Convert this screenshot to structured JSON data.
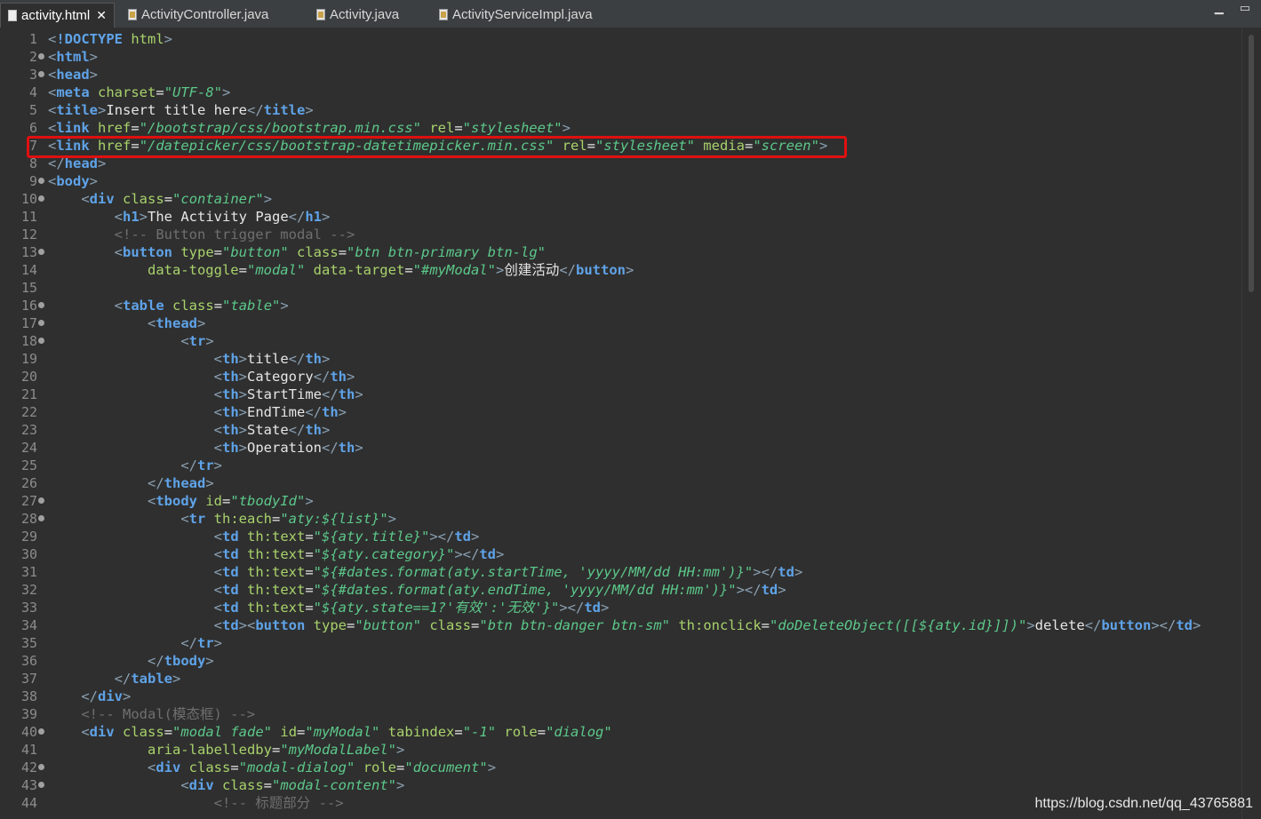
{
  "tabs": [
    {
      "label": "activity.html",
      "active": true,
      "icon": "html-file-icon"
    },
    {
      "label": "ActivityController.java",
      "active": false,
      "icon": "java-file-icon"
    },
    {
      "label": "Activity.java",
      "active": false,
      "icon": "java-file-icon"
    },
    {
      "label": "ActivityServiceImpl.java",
      "active": false,
      "icon": "java-file-icon"
    }
  ],
  "window_controls": [
    "minimize-icon",
    "maximize-icon"
  ],
  "close_glyph": "✕",
  "line_numbers": [
    "1",
    "2",
    "3",
    "4",
    "5",
    "6",
    "7",
    "8",
    "9",
    "10",
    "11",
    "12",
    "13",
    "14",
    "15",
    "16",
    "17",
    "18",
    "19",
    "20",
    "21",
    "22",
    "23",
    "24",
    "25",
    "26",
    "27",
    "28",
    "29",
    "30",
    "31",
    "32",
    "33",
    "34",
    "35",
    "36",
    "37",
    "38",
    "39",
    "40",
    "41",
    "42",
    "43",
    "44"
  ],
  "folded_lines": [
    2,
    3,
    9,
    10,
    13,
    16,
    17,
    18,
    27,
    28,
    40,
    42,
    43
  ],
  "highlighted_line": 7,
  "code_lines": [
    [
      [
        "p",
        "<"
      ],
      [
        "t",
        "!DOCTYPE"
      ],
      [
        "x",
        " "
      ],
      [
        "a",
        "html"
      ],
      [
        "p",
        ">"
      ]
    ],
    [
      [
        "p",
        "<"
      ],
      [
        "t",
        "html"
      ],
      [
        "p",
        ">"
      ]
    ],
    [
      [
        "p",
        "<"
      ],
      [
        "t",
        "head"
      ],
      [
        "p",
        ">"
      ]
    ],
    [
      [
        "p",
        "<"
      ],
      [
        "t",
        "meta"
      ],
      [
        "x",
        " "
      ],
      [
        "a",
        "charset"
      ],
      [
        "x",
        "="
      ],
      [
        "v",
        "\"UTF-8\""
      ],
      [
        "p",
        ">"
      ]
    ],
    [
      [
        "p",
        "<"
      ],
      [
        "t",
        "title"
      ],
      [
        "p",
        ">"
      ],
      [
        "x",
        "Insert title here"
      ],
      [
        "p",
        "</"
      ],
      [
        "t",
        "title"
      ],
      [
        "p",
        ">"
      ]
    ],
    [
      [
        "p",
        "<"
      ],
      [
        "t",
        "link"
      ],
      [
        "x",
        " "
      ],
      [
        "a",
        "href"
      ],
      [
        "x",
        "="
      ],
      [
        "v",
        "\"/bootstrap/css/bootstrap.min.css\""
      ],
      [
        "x",
        " "
      ],
      [
        "a",
        "rel"
      ],
      [
        "x",
        "="
      ],
      [
        "v",
        "\"stylesheet\""
      ],
      [
        "p",
        ">"
      ]
    ],
    [
      [
        "p",
        "<"
      ],
      [
        "t",
        "link"
      ],
      [
        "x",
        " "
      ],
      [
        "a",
        "href"
      ],
      [
        "x",
        "="
      ],
      [
        "v",
        "\"/datepicker/css/bootstrap-datetimepicker.min.css\""
      ],
      [
        "x",
        " "
      ],
      [
        "a",
        "rel"
      ],
      [
        "x",
        "="
      ],
      [
        "v",
        "\"stylesheet\""
      ],
      [
        "x",
        " "
      ],
      [
        "a",
        "media"
      ],
      [
        "x",
        "="
      ],
      [
        "v",
        "\"screen\""
      ],
      [
        "p",
        ">"
      ]
    ],
    [
      [
        "p",
        "</"
      ],
      [
        "t",
        "head"
      ],
      [
        "p",
        ">"
      ]
    ],
    [
      [
        "p",
        "<"
      ],
      [
        "t",
        "body"
      ],
      [
        "p",
        ">"
      ]
    ],
    [
      [
        "x",
        "    "
      ],
      [
        "p",
        "<"
      ],
      [
        "t",
        "div"
      ],
      [
        "x",
        " "
      ],
      [
        "a",
        "class"
      ],
      [
        "x",
        "="
      ],
      [
        "v",
        "\"container\""
      ],
      [
        "p",
        ">"
      ]
    ],
    [
      [
        "x",
        "        "
      ],
      [
        "p",
        "<"
      ],
      [
        "t",
        "h1"
      ],
      [
        "p",
        ">"
      ],
      [
        "x",
        "The Activity Page"
      ],
      [
        "p",
        "</"
      ],
      [
        "t",
        "h1"
      ],
      [
        "p",
        ">"
      ]
    ],
    [
      [
        "x",
        "        "
      ],
      [
        "c",
        "<!-- Button trigger modal -->"
      ]
    ],
    [
      [
        "x",
        "        "
      ],
      [
        "p",
        "<"
      ],
      [
        "t",
        "button"
      ],
      [
        "x",
        " "
      ],
      [
        "a",
        "type"
      ],
      [
        "x",
        "="
      ],
      [
        "v",
        "\"button\""
      ],
      [
        "x",
        " "
      ],
      [
        "a",
        "class"
      ],
      [
        "x",
        "="
      ],
      [
        "v",
        "\"btn btn-primary btn-lg\""
      ]
    ],
    [
      [
        "x",
        "            "
      ],
      [
        "a",
        "data-toggle"
      ],
      [
        "x",
        "="
      ],
      [
        "v",
        "\"modal\""
      ],
      [
        "x",
        " "
      ],
      [
        "a",
        "data-target"
      ],
      [
        "x",
        "="
      ],
      [
        "v",
        "\"#myModal\""
      ],
      [
        "p",
        ">"
      ],
      [
        "x",
        "创建活动"
      ],
      [
        "p",
        "</"
      ],
      [
        "t",
        "button"
      ],
      [
        "p",
        ">"
      ]
    ],
    [
      [
        "x",
        ""
      ]
    ],
    [
      [
        "x",
        "        "
      ],
      [
        "p",
        "<"
      ],
      [
        "t",
        "table"
      ],
      [
        "x",
        " "
      ],
      [
        "a",
        "class"
      ],
      [
        "x",
        "="
      ],
      [
        "v",
        "\"table\""
      ],
      [
        "p",
        ">"
      ]
    ],
    [
      [
        "x",
        "            "
      ],
      [
        "p",
        "<"
      ],
      [
        "t",
        "thead"
      ],
      [
        "p",
        ">"
      ]
    ],
    [
      [
        "x",
        "                "
      ],
      [
        "p",
        "<"
      ],
      [
        "t",
        "tr"
      ],
      [
        "p",
        ">"
      ]
    ],
    [
      [
        "x",
        "                    "
      ],
      [
        "p",
        "<"
      ],
      [
        "t",
        "th"
      ],
      [
        "p",
        ">"
      ],
      [
        "x",
        "title"
      ],
      [
        "p",
        "</"
      ],
      [
        "t",
        "th"
      ],
      [
        "p",
        ">"
      ]
    ],
    [
      [
        "x",
        "                    "
      ],
      [
        "p",
        "<"
      ],
      [
        "t",
        "th"
      ],
      [
        "p",
        ">"
      ],
      [
        "x",
        "Category"
      ],
      [
        "p",
        "</"
      ],
      [
        "t",
        "th"
      ],
      [
        "p",
        ">"
      ]
    ],
    [
      [
        "x",
        "                    "
      ],
      [
        "p",
        "<"
      ],
      [
        "t",
        "th"
      ],
      [
        "p",
        ">"
      ],
      [
        "x",
        "StartTime"
      ],
      [
        "p",
        "</"
      ],
      [
        "t",
        "th"
      ],
      [
        "p",
        ">"
      ]
    ],
    [
      [
        "x",
        "                    "
      ],
      [
        "p",
        "<"
      ],
      [
        "t",
        "th"
      ],
      [
        "p",
        ">"
      ],
      [
        "x",
        "EndTime"
      ],
      [
        "p",
        "</"
      ],
      [
        "t",
        "th"
      ],
      [
        "p",
        ">"
      ]
    ],
    [
      [
        "x",
        "                    "
      ],
      [
        "p",
        "<"
      ],
      [
        "t",
        "th"
      ],
      [
        "p",
        ">"
      ],
      [
        "x",
        "State"
      ],
      [
        "p",
        "</"
      ],
      [
        "t",
        "th"
      ],
      [
        "p",
        ">"
      ]
    ],
    [
      [
        "x",
        "                    "
      ],
      [
        "p",
        "<"
      ],
      [
        "t",
        "th"
      ],
      [
        "p",
        ">"
      ],
      [
        "x",
        "Operation"
      ],
      [
        "p",
        "</"
      ],
      [
        "t",
        "th"
      ],
      [
        "p",
        ">"
      ]
    ],
    [
      [
        "x",
        "                "
      ],
      [
        "p",
        "</"
      ],
      [
        "t",
        "tr"
      ],
      [
        "p",
        ">"
      ]
    ],
    [
      [
        "x",
        "            "
      ],
      [
        "p",
        "</"
      ],
      [
        "t",
        "thead"
      ],
      [
        "p",
        ">"
      ]
    ],
    [
      [
        "x",
        "            "
      ],
      [
        "p",
        "<"
      ],
      [
        "t",
        "tbody"
      ],
      [
        "x",
        " "
      ],
      [
        "a",
        "id"
      ],
      [
        "x",
        "="
      ],
      [
        "v",
        "\"tbodyId\""
      ],
      [
        "p",
        ">"
      ]
    ],
    [
      [
        "x",
        "                "
      ],
      [
        "p",
        "<"
      ],
      [
        "t",
        "tr"
      ],
      [
        "x",
        " "
      ],
      [
        "a",
        "th:each"
      ],
      [
        "x",
        "="
      ],
      [
        "v",
        "\"aty:${list}\""
      ],
      [
        "p",
        ">"
      ]
    ],
    [
      [
        "x",
        "                    "
      ],
      [
        "p",
        "<"
      ],
      [
        "t",
        "td"
      ],
      [
        "x",
        " "
      ],
      [
        "a",
        "th:text"
      ],
      [
        "x",
        "="
      ],
      [
        "v",
        "\"${aty.title}\""
      ],
      [
        "p",
        "></"
      ],
      [
        "t",
        "td"
      ],
      [
        "p",
        ">"
      ]
    ],
    [
      [
        "x",
        "                    "
      ],
      [
        "p",
        "<"
      ],
      [
        "t",
        "td"
      ],
      [
        "x",
        " "
      ],
      [
        "a",
        "th:text"
      ],
      [
        "x",
        "="
      ],
      [
        "v",
        "\"${aty.category}\""
      ],
      [
        "p",
        "></"
      ],
      [
        "t",
        "td"
      ],
      [
        "p",
        ">"
      ]
    ],
    [
      [
        "x",
        "                    "
      ],
      [
        "p",
        "<"
      ],
      [
        "t",
        "td"
      ],
      [
        "x",
        " "
      ],
      [
        "a",
        "th:text"
      ],
      [
        "x",
        "="
      ],
      [
        "v",
        "\"${#dates.format(aty.startTime, 'yyyy/MM/dd HH:mm')}\""
      ],
      [
        "p",
        "></"
      ],
      [
        "t",
        "td"
      ],
      [
        "p",
        ">"
      ]
    ],
    [
      [
        "x",
        "                    "
      ],
      [
        "p",
        "<"
      ],
      [
        "t",
        "td"
      ],
      [
        "x",
        " "
      ],
      [
        "a",
        "th:text"
      ],
      [
        "x",
        "="
      ],
      [
        "v",
        "\"${#dates.format(aty.endTime, 'yyyy/MM/dd HH:mm')}\""
      ],
      [
        "p",
        "></"
      ],
      [
        "t",
        "td"
      ],
      [
        "p",
        ">"
      ]
    ],
    [
      [
        "x",
        "                    "
      ],
      [
        "p",
        "<"
      ],
      [
        "t",
        "td"
      ],
      [
        "x",
        " "
      ],
      [
        "a",
        "th:text"
      ],
      [
        "x",
        "="
      ],
      [
        "v",
        "\"${aty.state==1?'有效':'无效'}\""
      ],
      [
        "p",
        "></"
      ],
      [
        "t",
        "td"
      ],
      [
        "p",
        ">"
      ]
    ],
    [
      [
        "x",
        "                    "
      ],
      [
        "p",
        "<"
      ],
      [
        "t",
        "td"
      ],
      [
        "p",
        "><"
      ],
      [
        "t",
        "button"
      ],
      [
        "x",
        " "
      ],
      [
        "a",
        "type"
      ],
      [
        "x",
        "="
      ],
      [
        "v",
        "\"button\""
      ],
      [
        "x",
        " "
      ],
      [
        "a",
        "class"
      ],
      [
        "x",
        "="
      ],
      [
        "v",
        "\"btn btn-danger btn-sm\""
      ],
      [
        "x",
        " "
      ],
      [
        "a",
        "th:onclick"
      ],
      [
        "x",
        "="
      ],
      [
        "v",
        "\"doDeleteObject([[${aty.id}]])\""
      ],
      [
        "p",
        ">"
      ],
      [
        "x",
        "delete"
      ],
      [
        "p",
        "</"
      ],
      [
        "t",
        "button"
      ],
      [
        "p",
        "></"
      ],
      [
        "t",
        "td"
      ],
      [
        "p",
        ">"
      ]
    ],
    [
      [
        "x",
        "                "
      ],
      [
        "p",
        "</"
      ],
      [
        "t",
        "tr"
      ],
      [
        "p",
        ">"
      ]
    ],
    [
      [
        "x",
        "            "
      ],
      [
        "p",
        "</"
      ],
      [
        "t",
        "tbody"
      ],
      [
        "p",
        ">"
      ]
    ],
    [
      [
        "x",
        "        "
      ],
      [
        "p",
        "</"
      ],
      [
        "t",
        "table"
      ],
      [
        "p",
        ">"
      ]
    ],
    [
      [
        "x",
        "    "
      ],
      [
        "p",
        "</"
      ],
      [
        "t",
        "div"
      ],
      [
        "p",
        ">"
      ]
    ],
    [
      [
        "x",
        "    "
      ],
      [
        "c",
        "<!-- Modal(模态框) -->"
      ]
    ],
    [
      [
        "x",
        "    "
      ],
      [
        "p",
        "<"
      ],
      [
        "t",
        "div"
      ],
      [
        "x",
        " "
      ],
      [
        "a",
        "class"
      ],
      [
        "x",
        "="
      ],
      [
        "v",
        "\"modal fade\""
      ],
      [
        "x",
        " "
      ],
      [
        "a",
        "id"
      ],
      [
        "x",
        "="
      ],
      [
        "v",
        "\"myModal\""
      ],
      [
        "x",
        " "
      ],
      [
        "a",
        "tabindex"
      ],
      [
        "x",
        "="
      ],
      [
        "v",
        "\"-1\""
      ],
      [
        "x",
        " "
      ],
      [
        "a",
        "role"
      ],
      [
        "x",
        "="
      ],
      [
        "v",
        "\"dialog\""
      ]
    ],
    [
      [
        "x",
        "            "
      ],
      [
        "a",
        "aria-labelledby"
      ],
      [
        "x",
        "="
      ],
      [
        "v",
        "\"myModalLabel\""
      ],
      [
        "p",
        ">"
      ]
    ],
    [
      [
        "x",
        "            "
      ],
      [
        "p",
        "<"
      ],
      [
        "t",
        "div"
      ],
      [
        "x",
        " "
      ],
      [
        "a",
        "class"
      ],
      [
        "x",
        "="
      ],
      [
        "v",
        "\"modal-dialog\""
      ],
      [
        "x",
        " "
      ],
      [
        "a",
        "role"
      ],
      [
        "x",
        "="
      ],
      [
        "v",
        "\"document\""
      ],
      [
        "p",
        ">"
      ]
    ],
    [
      [
        "x",
        "                "
      ],
      [
        "p",
        "<"
      ],
      [
        "t",
        "div"
      ],
      [
        "x",
        " "
      ],
      [
        "a",
        "class"
      ],
      [
        "x",
        "="
      ],
      [
        "v",
        "\"modal-content\""
      ],
      [
        "p",
        ">"
      ]
    ],
    [
      [
        "x",
        "                    "
      ],
      [
        "c",
        "<!-- 标题部分 -->"
      ]
    ]
  ],
  "watermark": "https://blog.csdn.net/qq_43765881"
}
